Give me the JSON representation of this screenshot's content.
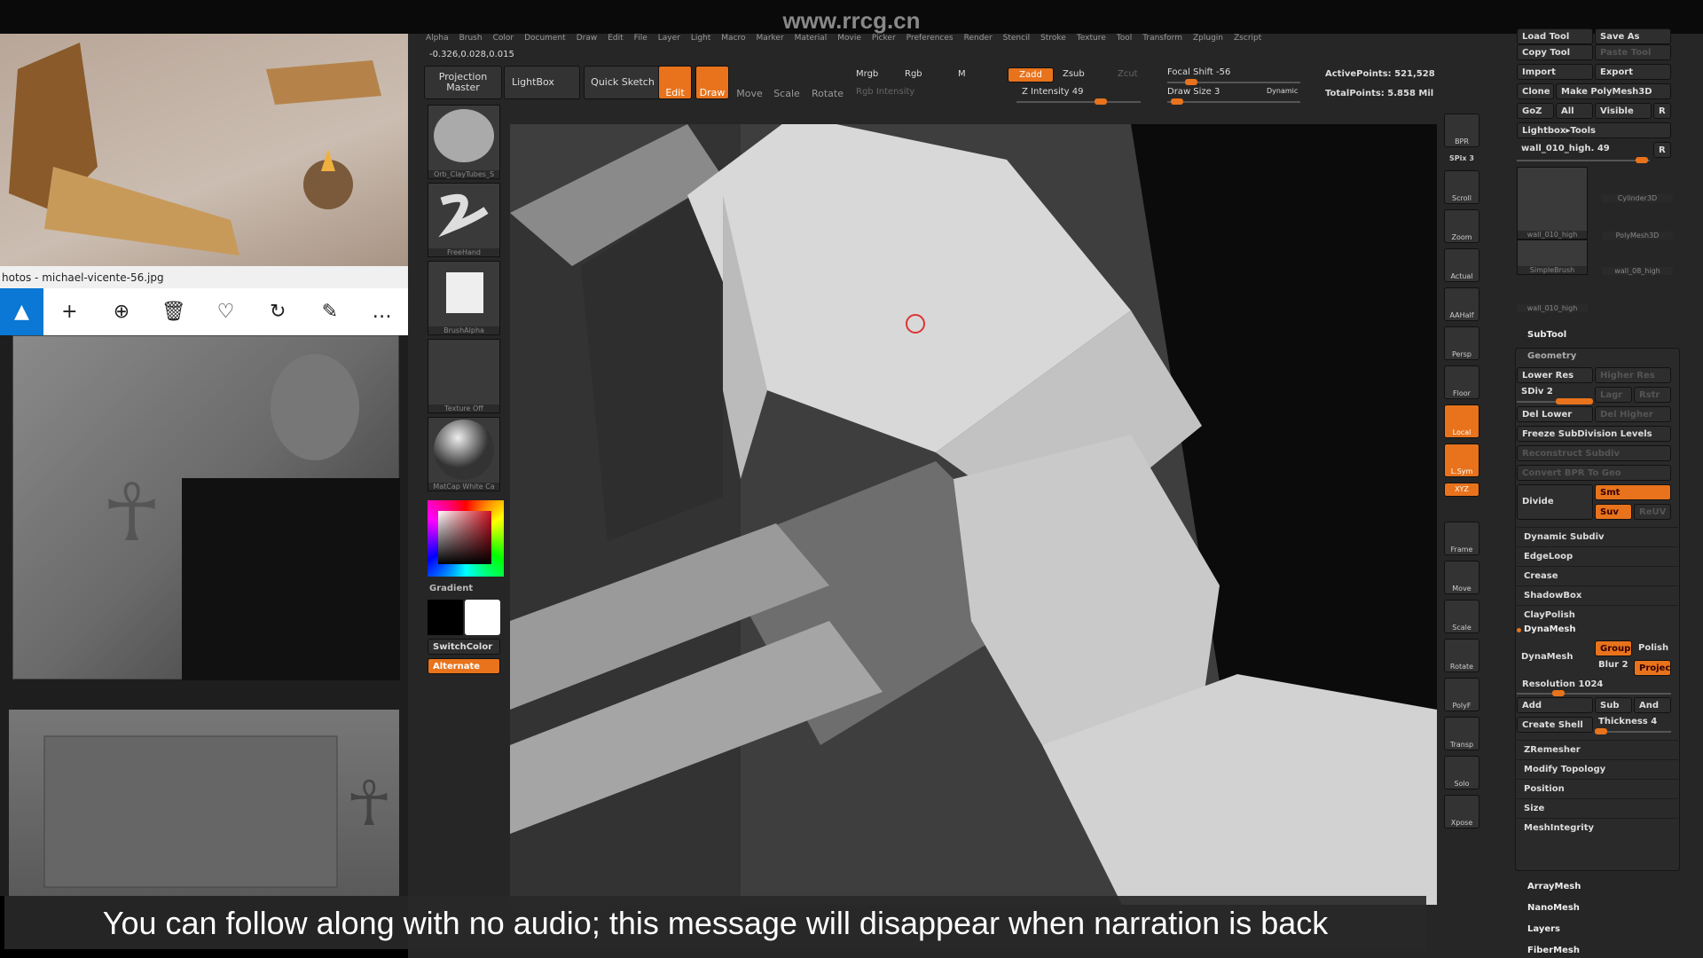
{
  "watermark": "www.rrcg.cn",
  "photos": {
    "title": "hotos - michael-vicente-56.jpg",
    "toolbar_icons": [
      "photo-icon",
      "add-icon",
      "zoom-in-icon",
      "delete-icon",
      "heart-icon",
      "rotate-icon",
      "edit-icon",
      "more-icon"
    ]
  },
  "zbrush": {
    "menu": [
      "Alpha",
      "Brush",
      "Color",
      "Document",
      "Draw",
      "Edit",
      "File",
      "Layer",
      "Light",
      "Macro",
      "Marker",
      "Material",
      "Movie",
      "Picker",
      "Preferences",
      "Render",
      "Stencil",
      "Stroke",
      "Texture",
      "Tool",
      "Transform",
      "Zplugin",
      "Zscript"
    ],
    "coords": "-0.326,0.028,0.015",
    "toolbar": {
      "projection_master": "Projection Master",
      "lightbox": "LightBox",
      "quick_sketch": "Quick Sketch",
      "edit": "Edit",
      "draw": "Draw",
      "move": "Move",
      "scale": "Scale",
      "rotate": "Rotate",
      "mrgb": "Mrgb",
      "rgb": "Rgb",
      "m": "M",
      "rgb_intensity": "Rgb Intensity",
      "zadd": "Zadd",
      "zsub": "Zsub",
      "zcut": "Zcut",
      "z_intensity": "Z Intensity 49",
      "focal_shift": "Focal Shift -56",
      "draw_size": "Draw Size 3",
      "dynamic": "Dynamic",
      "active_points": "ActivePoints: 521,528",
      "total_points": "TotalPoints: 5.858 Mil",
      "z_intensity_value": 49,
      "focal_shift_value": -56,
      "draw_size_value": 3
    },
    "left_shelf": {
      "brush": "Orb_ClayTubes_S",
      "stroke": "FreeHand",
      "alpha": "BrushAlpha",
      "texture": "Texture Off",
      "material": "MatCap White Ca",
      "gradient": "Gradient",
      "switch_color": "SwitchColor",
      "alternate": "Alternate"
    },
    "right_shelf": [
      {
        "label": "BPR"
      },
      {
        "label": "SPix 3"
      },
      {
        "label": "Scroll"
      },
      {
        "label": "Zoom"
      },
      {
        "label": "Actual"
      },
      {
        "label": "AAHalf"
      },
      {
        "label": "Persp"
      },
      {
        "label": "Floor"
      },
      {
        "label": "Local",
        "on": true
      },
      {
        "label": "L.Sym",
        "on": true
      },
      {
        "label": "XYZ",
        "on": true
      },
      {
        "label": "Frame"
      },
      {
        "label": "Move"
      },
      {
        "label": "Scale"
      },
      {
        "label": "Rotate"
      },
      {
        "label": "PolyF"
      },
      {
        "label": "Transp"
      },
      {
        "label": "Solo"
      },
      {
        "label": "Xpose"
      }
    ],
    "tool": {
      "load": "Load Tool",
      "save": "Save As",
      "copy": "Copy Tool",
      "paste": "Paste Tool",
      "import": "Import",
      "export": "Export",
      "clone": "Clone",
      "make_polymesh": "Make PolyMesh3D",
      "goz": "GoZ",
      "all": "All",
      "visible": "Visible",
      "r": "R",
      "lightbox_tools": "Lightbox▸Tools",
      "current": "wall_010_high. 49",
      "thumbs": [
        "wall_010_high",
        "Cylinder3D",
        "PolyMesh3D",
        "SimpleBrush",
        "wall_08_high",
        "wall_010_high"
      ]
    },
    "subtool": "SubTool",
    "geometry": {
      "title": "Geometry",
      "lower_res": "Lower Res",
      "higher_res": "Higher Res",
      "sdiv": "SDiv 2",
      "lagr": "Lagr",
      "rstr": "Rstr",
      "del_lower": "Del Lower",
      "del_higher": "Del Higher",
      "freeze": "Freeze SubDivision Levels",
      "reconstruct": "Reconstruct Subdiv",
      "convert_bpr": "Convert BPR To Geo",
      "divide": "Divide",
      "smt": "Smt",
      "suv": "Suv",
      "reuv": "ReUV",
      "rows": [
        "Dynamic Subdiv",
        "EdgeLoop",
        "Crease",
        "ShadowBox",
        "ClayPolish"
      ],
      "dynamesh_header": "DynaMesh",
      "dynamesh": "DynaMesh",
      "groups": "Groups",
      "polish": "Polish",
      "blur": "Blur 2",
      "project": "Projec",
      "resolution": "Resolution 1024",
      "add": "Add",
      "sub": "Sub",
      "and": "And",
      "create_shell": "Create Shell",
      "thickness": "Thickness 4",
      "rows2": [
        "ZRemesher",
        "Modify Topology",
        "Position",
        "Size",
        "MeshIntegrity"
      ]
    },
    "sections": [
      "ArrayMesh",
      "NanoMesh",
      "Layers",
      "FiberMesh"
    ]
  },
  "caption": "You can follow along with no audio; this message will disappear when narration is back",
  "colors": {
    "accent": "#e8731c",
    "panel": "#262626"
  }
}
